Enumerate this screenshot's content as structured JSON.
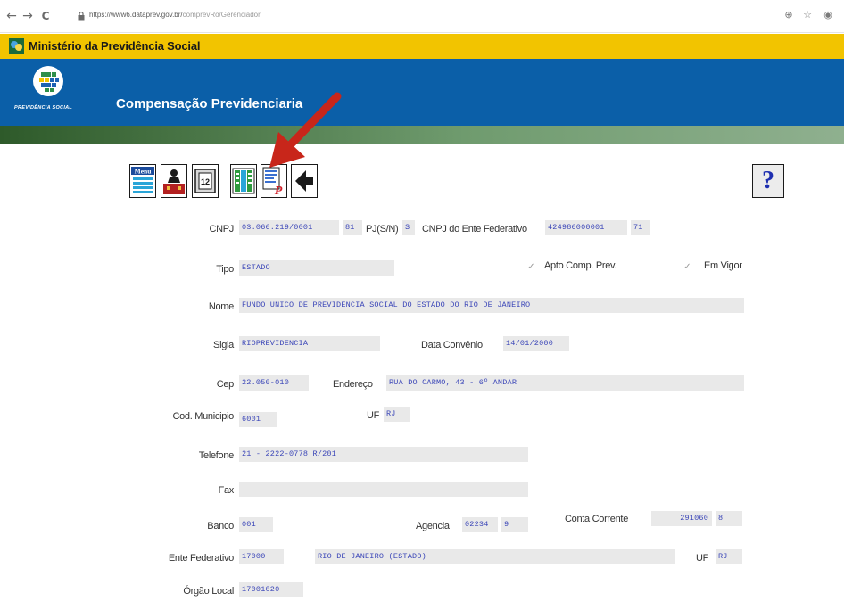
{
  "browser": {
    "nav": {
      "back": "←",
      "forward": "→",
      "reload": "C"
    },
    "url_host": "https://www6.dataprev.gov.br/",
    "url_path": "comprevRo/Gerenciador",
    "right_icons": {
      "zoom": "⊕",
      "star": "☆",
      "account": "◉"
    }
  },
  "header": {
    "ministry_title": "Ministério da Previdência Social",
    "logo_caption": "PREVIDÊNCIA SOCIAL",
    "app_title": "Compensação Previdenciaria"
  },
  "toolbar": {
    "help_label": "?",
    "icons": [
      "menu-icon",
      "user-icon",
      "calculator-icon",
      "grid-icon",
      "document-p-icon",
      "back-arrow-icon"
    ]
  },
  "form": {
    "cnpj": {
      "label": "CNPJ",
      "value": "03.066.219/0001",
      "dv": "81"
    },
    "pj": {
      "label": "PJ(S/N)",
      "value": "S"
    },
    "cnpj_ente": {
      "label": "CNPJ do Ente Federativo",
      "value": "424986000001",
      "dv": "71"
    },
    "tipo": {
      "label": "Tipo",
      "value": "ESTADO"
    },
    "apto": {
      "label": "Apto Comp. Prev.",
      "check": "✓"
    },
    "em_vigor": {
      "label": "Em Vigor",
      "check": "✓"
    },
    "nome": {
      "label": "Nome",
      "value": "FUNDO UNICO DE PREVIDENCIA SOCIAL DO ESTADO DO RIO DE JANEIRO"
    },
    "sigla": {
      "label": "Sigla",
      "value": "RIOPREVIDENCIA"
    },
    "data_convenio": {
      "label": "Data Convênio",
      "value": "14/01/2000"
    },
    "cep": {
      "label": "Cep",
      "value": "22.050-010"
    },
    "endereco": {
      "label": "Endereço",
      "value": "RUA DO CARMO, 43 - 6º ANDAR"
    },
    "cod_municipio": {
      "label": "Cod. Municipio",
      "value": "6001"
    },
    "uf": {
      "label": "UF",
      "value": "RJ"
    },
    "telefone": {
      "label": "Telefone",
      "value": "21 - 2222-0778 R/201"
    },
    "fax": {
      "label": "Fax",
      "value": ""
    },
    "banco": {
      "label": "Banco",
      "value": "001"
    },
    "agencia": {
      "label": "Agencia",
      "value": "02234",
      "dv": "9"
    },
    "conta": {
      "label": "Conta Corrente",
      "value": "291060",
      "dv": "8"
    },
    "ente": {
      "label": "Ente Federativo",
      "code": "17000",
      "name": "RIO DE JANEIRO (ESTADO)"
    },
    "uf2": {
      "label": "UF",
      "value": "RJ"
    },
    "orgao": {
      "label": "Órgão Local",
      "value": "17001020"
    }
  },
  "colors": {
    "ministry_bar": "#f2c400",
    "banner": "#0b5fa8",
    "field_text": "#3b46b8",
    "arrow": "#c8261a"
  }
}
